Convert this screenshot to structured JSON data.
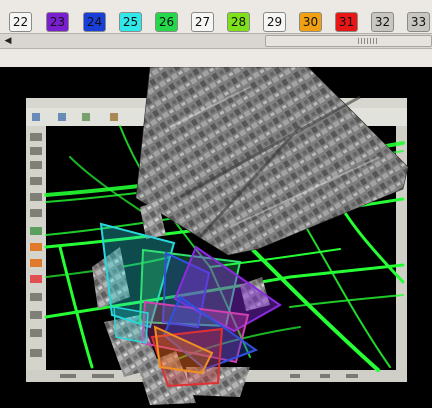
{
  "palette": {
    "swatches": [
      {
        "label": "22",
        "color": "#f6f6f4"
      },
      {
        "label": "23",
        "color": "#7a1fd0"
      },
      {
        "label": "24",
        "color": "#1a3ed8"
      },
      {
        "label": "25",
        "color": "#2ee8ea"
      },
      {
        "label": "26",
        "color": "#25d84a"
      },
      {
        "label": "27",
        "color": "#f6f6f4"
      },
      {
        "label": "28",
        "color": "#7fe01c"
      },
      {
        "label": "29",
        "color": "#f6f6f4"
      },
      {
        "label": "30",
        "color": "#f0a010"
      },
      {
        "label": "31",
        "color": "#e81616"
      },
      {
        "label": "32",
        "color": "#c8c6c0"
      },
      {
        "label": "33",
        "color": "#c8c6c0"
      }
    ]
  },
  "scrollbar": {
    "left_arrow": "◀"
  },
  "overlays": [
    {
      "name": "cyan",
      "color": "#28d8dc"
    },
    {
      "name": "green",
      "color": "#30e070"
    },
    {
      "name": "blue",
      "color": "#3050e0"
    },
    {
      "name": "purple",
      "color": "#8a2be0"
    },
    {
      "name": "magenta",
      "color": "#d040b0"
    },
    {
      "name": "red",
      "color": "#e03030"
    },
    {
      "name": "orange",
      "color": "#f09020"
    }
  ]
}
